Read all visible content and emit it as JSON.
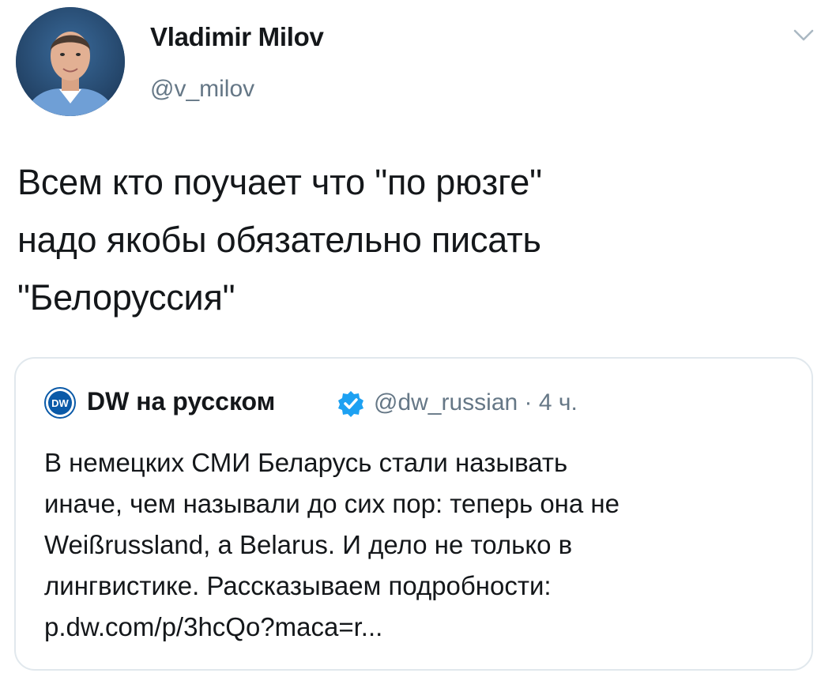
{
  "tweet": {
    "author": {
      "name": "Vladimir Milov",
      "handle": "@v_milov",
      "avatar_icon": "user-photo-avatar"
    },
    "menu_icon": "chevron-down-icon",
    "text_lines": [
      "Всем кто поучает что \"по рюзге\"",
      "надо якобы обязательно писать",
      "\"Белоруссия\""
    ],
    "quote": {
      "logo_icon": "dw-logo-icon",
      "author_name": "DW на русском",
      "verified_icon": "verified-badge-icon",
      "meta": "@dw_russian · 4 ч.",
      "text_lines": [
        "В немецких СМИ Беларусь стали называть",
        "иначе, чем называли до сих пор: теперь она не",
        "Weißrussland, а Belarus. И дело не только в",
        "лингвистике. Рассказываем подробности:",
        "p.dw.com/p/3hcQo?maca=r..."
      ]
    }
  },
  "colors": {
    "text_primary": "#14171a",
    "text_secondary": "#657786",
    "border": "#e1e8ed",
    "verified_blue": "#1da1f2",
    "dw_blue": "#0a5aa8"
  }
}
